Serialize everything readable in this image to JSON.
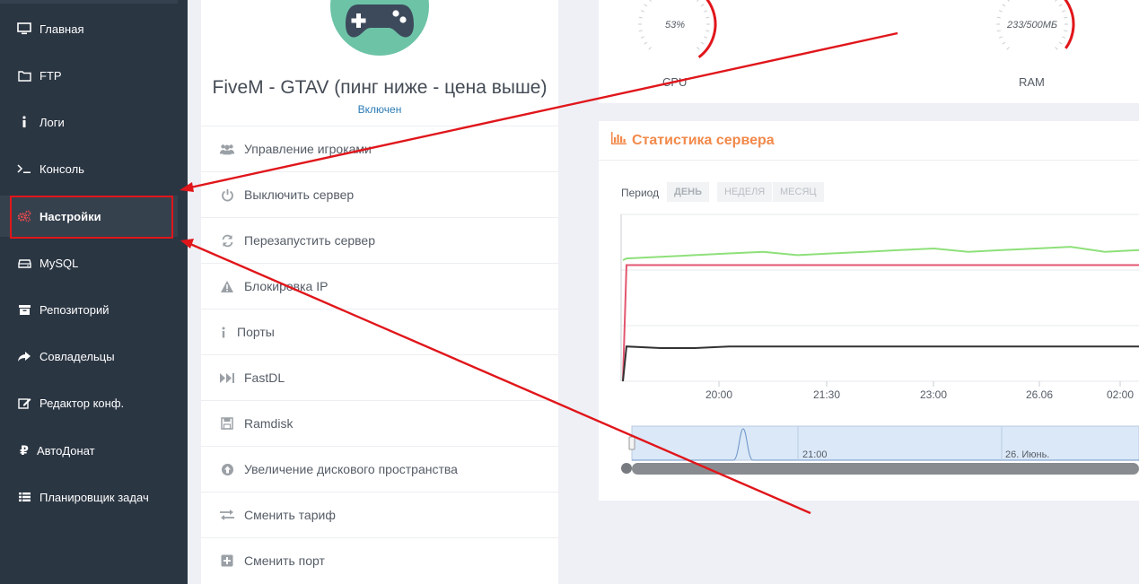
{
  "sidebar": {
    "items": [
      {
        "label": "Главная",
        "icon": "monitor-icon"
      },
      {
        "label": "FTP",
        "icon": "folder-icon"
      },
      {
        "label": "Логи",
        "icon": "info-icon"
      },
      {
        "label": "Консоль",
        "icon": "terminal-icon"
      },
      {
        "label": "Настройки",
        "icon": "gears-icon"
      },
      {
        "label": "MySQL",
        "icon": "database-icon"
      },
      {
        "label": "Репозиторий",
        "icon": "archive-icon"
      },
      {
        "label": "Совладельцы",
        "icon": "share-icon"
      },
      {
        "label": "Редактор конф.",
        "icon": "edit-icon"
      },
      {
        "label": "АвтоДонат",
        "icon": "ruble-icon"
      },
      {
        "label": "Планировщик задач",
        "icon": "list-icon"
      }
    ],
    "active_index": 4
  },
  "server": {
    "title": "FiveM - GTAV (пинг ниже - цена выше)",
    "status": "Включен",
    "avatar_icon": "gamepad-icon"
  },
  "menu": {
    "items": [
      {
        "label": "Управление игроками",
        "icon": "users-icon"
      },
      {
        "label": "Выключить сервер",
        "icon": "power-icon"
      },
      {
        "label": "Перезапустить сервер",
        "icon": "refresh-icon"
      },
      {
        "label": "Блокировка IP",
        "icon": "warning-icon"
      },
      {
        "label": "Порты",
        "icon": "info-icon"
      },
      {
        "label": "FastDL",
        "icon": "fast-forward-icon"
      },
      {
        "label": "Ramdisk",
        "icon": "save-icon"
      },
      {
        "label": "Увеличение дискового пространства",
        "icon": "arrow-up-circle-icon"
      },
      {
        "label": "Сменить тариф",
        "icon": "exchange-icon"
      },
      {
        "label": "Сменить порт",
        "icon": "plus-square-icon"
      }
    ]
  },
  "gauges": {
    "cpu": {
      "value": "53%",
      "label": "CPU",
      "fraction": 0.53
    },
    "ram": {
      "value": "233/500МБ",
      "label": "RAM",
      "fraction": 0.466
    }
  },
  "stats": {
    "title": "Статистика сервера",
    "title_icon": "bar-chart-icon",
    "period_label": "Период",
    "periods": [
      "ДЕНЬ",
      "НЕДЕЛЯ",
      "МЕСЯЦ"
    ],
    "active_period": 0,
    "navigator_labels": [
      "21:00",
      "26. Июнь."
    ]
  },
  "chart_data": {
    "type": "line",
    "x_tick_labels": [
      "20:00",
      "21:30",
      "23:00",
      "26.06",
      "02:00"
    ],
    "series": [
      {
        "color": "#8ee07a",
        "values": [
          73,
          74,
          75,
          76,
          77,
          78,
          76,
          77,
          78,
          79,
          80,
          78,
          79,
          80,
          81,
          78,
          79
        ]
      },
      {
        "color": "#e2566f",
        "values": [
          0,
          70,
          70,
          70,
          70,
          70,
          70,
          70,
          70,
          70,
          70,
          70,
          70,
          70,
          70,
          70,
          70
        ]
      },
      {
        "color": "#333333",
        "values": [
          0,
          21,
          20,
          20,
          21,
          21,
          21,
          21,
          21,
          21,
          21,
          21,
          21,
          21,
          21,
          21,
          21
        ]
      }
    ],
    "ylim": [
      0,
      100
    ],
    "grid": true,
    "colors": {
      "accent": "#f2894a",
      "gauge": "#e0161b"
    }
  },
  "annotation_colors": {
    "arrow": "#e0161b"
  }
}
